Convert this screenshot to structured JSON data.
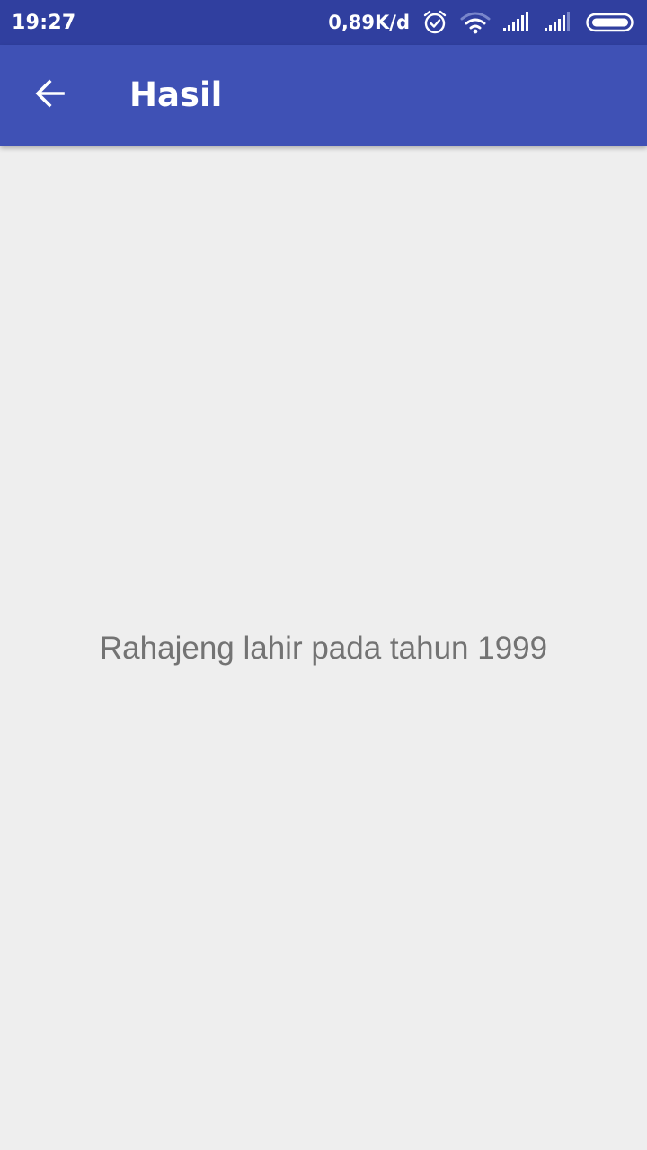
{
  "status_bar": {
    "time": "19:27",
    "network_speed": "0,89K/d",
    "icons": [
      "alarm-icon",
      "wifi-icon",
      "signal-icon",
      "signal-icon",
      "battery-icon"
    ]
  },
  "app_bar": {
    "title": "Hasil",
    "back_icon": "arrow-back-icon"
  },
  "content": {
    "result": "Rahajeng lahir pada tahun 1999"
  },
  "colors": {
    "status_bar": "#303f9f",
    "app_bar": "#3f51b5",
    "background": "#eeeeee",
    "text": "#737373"
  }
}
